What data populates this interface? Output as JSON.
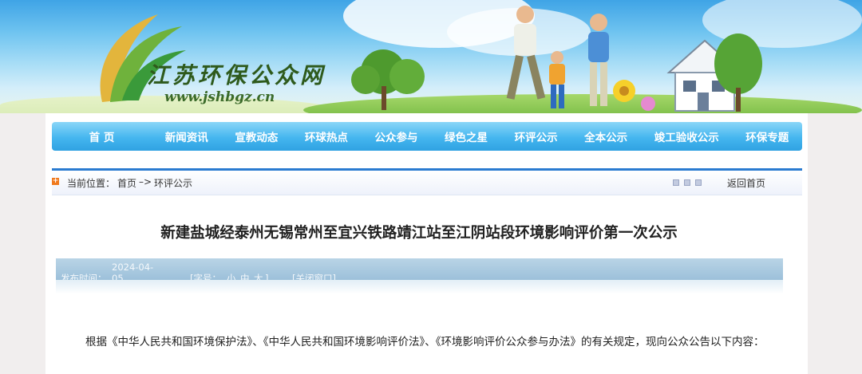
{
  "site": {
    "title": "江苏环保公众网",
    "url": "www.jshbgz.cn"
  },
  "nav": {
    "items": [
      "首 页",
      "新闻资讯",
      "宣教动态",
      "环球热点",
      "公众参与",
      "绿色之星",
      "环评公示",
      "全本公示",
      "竣工验收公示",
      "环保专题"
    ]
  },
  "breadcrumb": {
    "label": "当前位置：",
    "home": "首页",
    "separator": "–>",
    "current": "环评公示",
    "back_home": "返回首页"
  },
  "article": {
    "title": "新建盐城经泰州无锡常州至宜兴铁路靖江站至江阴站段环境影响评价第一次公示",
    "meta": {
      "publish_label": "发布时间：",
      "publish_date": "2024-04-05",
      "font_label": "[字号：",
      "font_small": "小",
      "font_medium": "中",
      "font_large": "大",
      "font_close": "]",
      "close_window": "[关闭窗口]"
    },
    "body": "根据《中华人民共和国环境保护法》、《中华人民共和国环境影响评价法》、《环境影响评价公众参与办法》的有关规定，现向公众公告以下内容："
  },
  "colors": {
    "nav_top": "#8ad6f8",
    "nav_bottom": "#2fa2e2",
    "crumb_line": "#2a7bd0",
    "meta_bar": "#9cc0da",
    "crumb_icon": "#f07a1e"
  }
}
